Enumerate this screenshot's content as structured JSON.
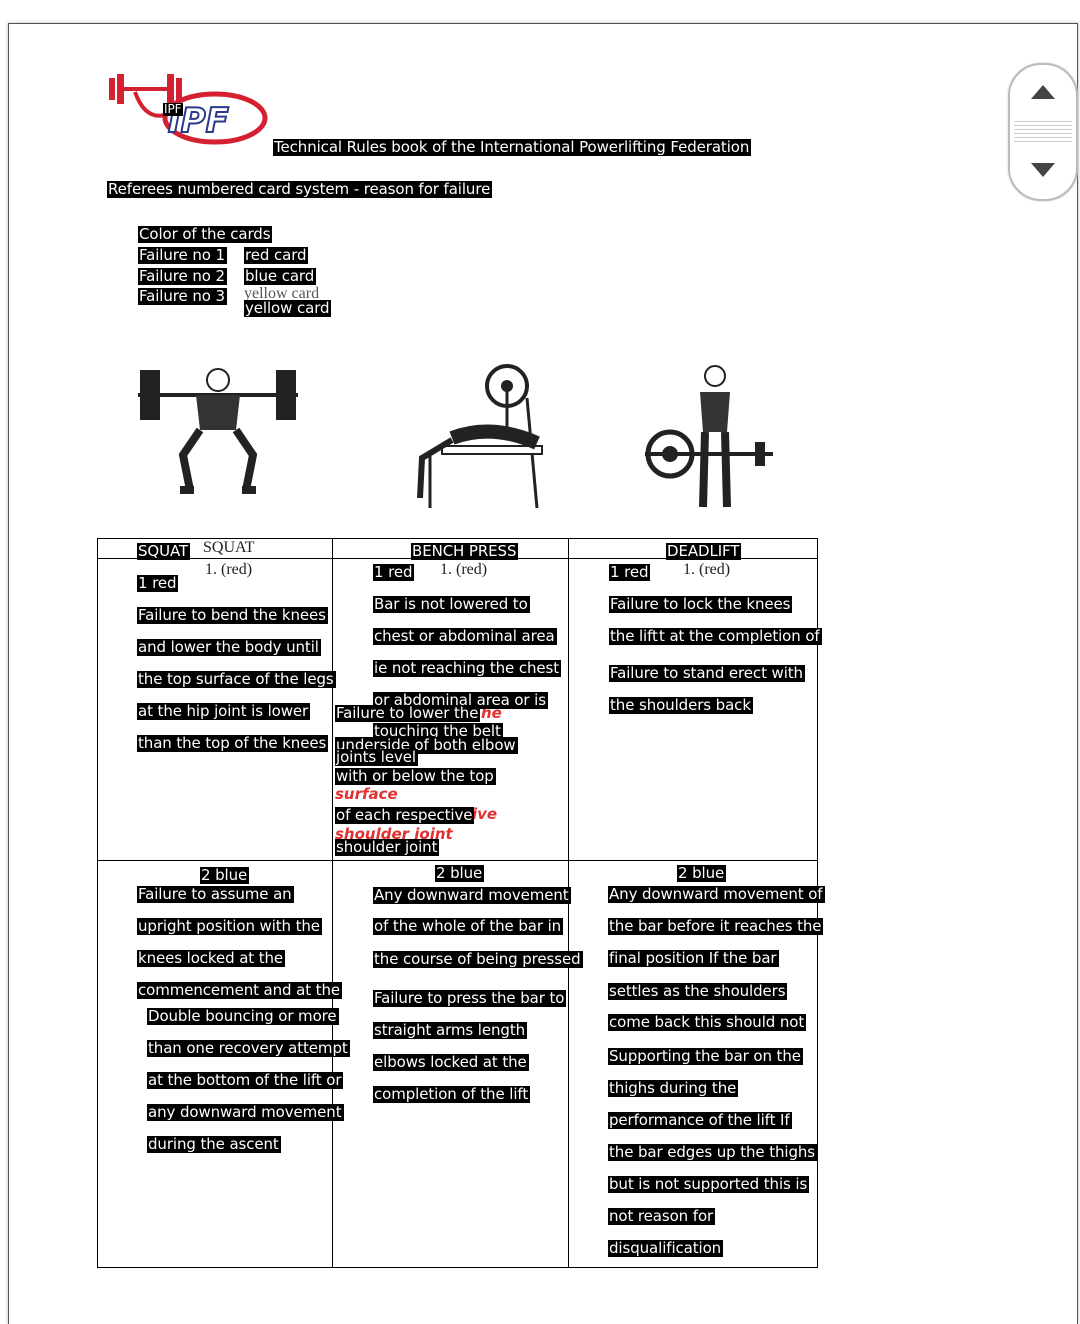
{
  "logo": {
    "text": "IPF",
    "overlay": "IPF",
    "color": "#d42030"
  },
  "header": {
    "title": "Technical Rules book of the International Powerlifting Federation",
    "subtitle": "Referees numbered card system - reason for failure"
  },
  "cards": {
    "heading": "Color of the cards",
    "rows": [
      {
        "failure": "Failure no 1",
        "card": "red card"
      },
      {
        "failure": "Failure no 2",
        "card": "blue card"
      },
      {
        "failure": "Failure no 3",
        "card": "yellow card",
        "underlying": "yellow card"
      }
    ]
  },
  "table": {
    "squat": {
      "header": "SQUAT",
      "header_underlying": "SQUAT",
      "num1": "1. (red)",
      "red_label": "1 red",
      "red_lines": [
        "Failure to bend the knees",
        "and lower the body until",
        "the top surface of the legs",
        "at the hip joint is lower",
        "than the top of the knees"
      ],
      "blue_label": "2 blue",
      "blue_lines": [
        "Failure to assume an",
        "upright position with the",
        "knees locked at the",
        "commencement and at the",
        "Double bouncing or more",
        "than one recovery attempt",
        "at the bottom of the lift or",
        "any downward movement",
        "during the ascent"
      ]
    },
    "bench": {
      "header": "BENCH PRESS",
      "num1": "1. (red)",
      "red_label": "1 red",
      "red_lines": [
        "Bar is not lowered to",
        "chest or abdominal area",
        "ie not reaching the chest",
        "or abdominal area or is",
        "Failure to lower the",
        "touching the belt",
        "underside of both elbow",
        "joints level",
        "with or below the top",
        "of each respective",
        "shoulder joint"
      ],
      "red_fragments": [
        "he",
        "surface",
        "ive",
        "shoulder joint"
      ],
      "blue_label": "2 blue",
      "blue_lines": [
        "Any downward movement",
        "of the whole of the bar in",
        "the course of being pressed",
        "Failure to press the bar to",
        "straight arms length",
        "elbows locked at the",
        "completion of the lift"
      ]
    },
    "deadlift": {
      "header": "DEADLIFT",
      "num1": "1. (red)",
      "red_label": "1 red",
      "red_lines": [
        "Failure to lock the knees",
        "the lift",
        "t at the completion of",
        "Failure to stand erect with",
        "the shoulders back"
      ],
      "blue_label": "2 blue",
      "blue_lines": [
        "Any downward movement of",
        "the bar before it reaches the",
        "final position If the bar",
        "settles as the shoulders",
        "come back this should not",
        "Supporting the bar on the",
        "thighs during the",
        "performance of the lift If",
        "the bar edges up the thighs",
        "but is not supported this is",
        "not reason for",
        "disqualification"
      ]
    }
  },
  "scrollbar": {
    "up_icon": "triangle-up-icon",
    "down_icon": "triangle-down-icon"
  }
}
